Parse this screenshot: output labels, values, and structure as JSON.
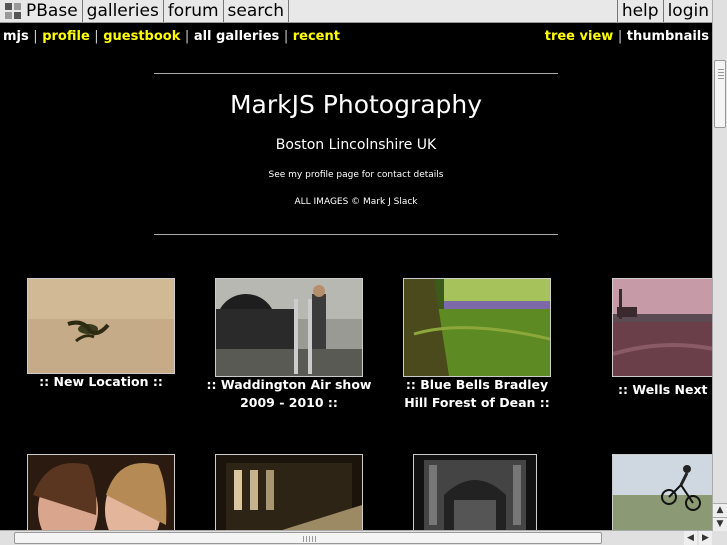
{
  "topnav": {
    "brand": "PBase",
    "galleries": "galleries",
    "forum": "forum",
    "search": "search",
    "help": "help",
    "login": "login"
  },
  "subnav": {
    "user": "mjs",
    "profile": "profile",
    "guestbook": "guestbook",
    "all_galleries": "all galleries",
    "recent": "recent",
    "tree_view": "tree view",
    "thumbnails": "thumbnails",
    "separator": "|"
  },
  "header": {
    "title": "MarkJS Photography",
    "location": "Boston Lincolnshire UK",
    "contact": "See my profile page for contact details",
    "copyright": "ALL IMAGES © Mark J Slack"
  },
  "galleries": [
    {
      "caption_line1": ":: New Location ::",
      "caption_line2": ""
    },
    {
      "caption_line1": ":: Waddington Air show",
      "caption_line2": "2009 - 2010 ::"
    },
    {
      "caption_line1": ":: Blue Bells Bradley",
      "caption_line2": "Hill Forest of Dean ::"
    },
    {
      "caption_line1": ":: Wells Next th",
      "caption_line2": ""
    }
  ],
  "icons": {
    "logo": "pbase-logo-icon",
    "scroll_up": "arrow-up-icon",
    "scroll_down": "arrow-down-icon",
    "scroll_left": "arrow-left-icon",
    "scroll_right": "arrow-right-icon"
  },
  "colors": {
    "background": "#000000",
    "link_yellow": "#ffff00",
    "link_white": "#ffffff",
    "nav_bg": "#e8e8e8"
  }
}
